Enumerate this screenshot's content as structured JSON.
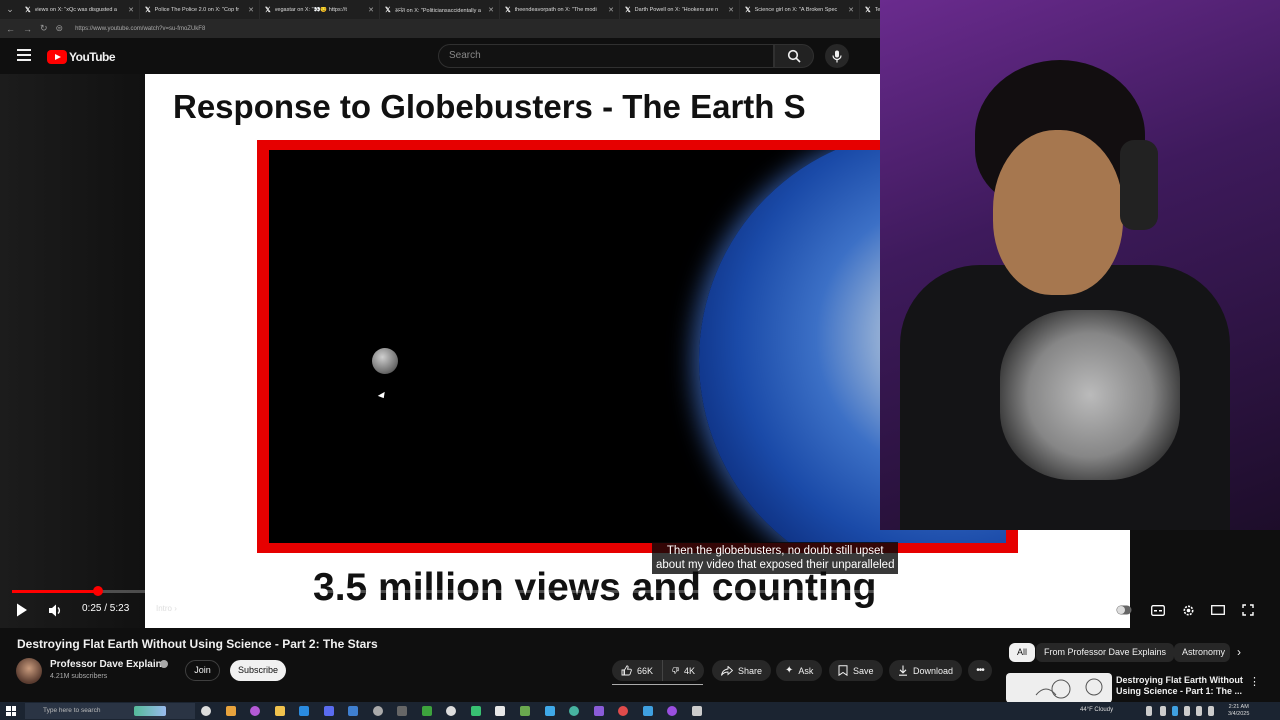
{
  "browser": {
    "tabs": [
      {
        "title": "views on X: \"xQc was disgusted a"
      },
      {
        "title": "Police The Police 2.0 on X: \"Cop fr"
      },
      {
        "title": "vegastar on X: \"👀😏 https://t"
      },
      {
        "title": "अनंत on X: \"Politiciansaccidentally a"
      },
      {
        "title": "theendeavorpath on X: \"The modi"
      },
      {
        "title": "Darth Powell on X: \"Hookers are n"
      },
      {
        "title": "Science girl on X: \"A Broken Spec"
      },
      {
        "title": "Te"
      }
    ],
    "url": "https://www.youtube.com/watch?v=su-fmoZUkF8"
  },
  "youtube": {
    "logo_text": "YouTube",
    "search_placeholder": "Search"
  },
  "video": {
    "slide_title": "Response to Globebusters - The Earth S",
    "slide_subtitle": "3.5 million views and counting",
    "caption_line1": "Then the globebusters, no doubt still upset",
    "caption_line2": "about my video that exposed their unparalleled",
    "time": "0:25 / 5:23",
    "chapter": "Intro",
    "progress_fraction": 0.078,
    "title": "Destroying Flat Earth Without Using Science - Part 2: The Stars"
  },
  "channel": {
    "name": "Professor Dave Explains",
    "subscribers": "4.21M subscribers",
    "join_label": "Join",
    "subscribe_label": "Subscribe"
  },
  "actions": {
    "likes": "66K",
    "dislikes": "4K",
    "share": "Share",
    "ask": "Ask",
    "save": "Save",
    "download": "Download"
  },
  "recommendations": {
    "chips": [
      "All",
      "From Professor Dave Explains",
      "Astronomy"
    ],
    "first_title": "Destroying Flat Earth Without Using Science - Part 1: The ..."
  },
  "taskbar": {
    "search_placeholder": "Type here to search",
    "weather": "44°F  Cloudy",
    "time": "2:21 AM",
    "date": "3/4/2025"
  },
  "colors": {
    "accent": "#ff0000",
    "background": "#0f0f0f",
    "webcam_purple": "#6a2b8e"
  }
}
